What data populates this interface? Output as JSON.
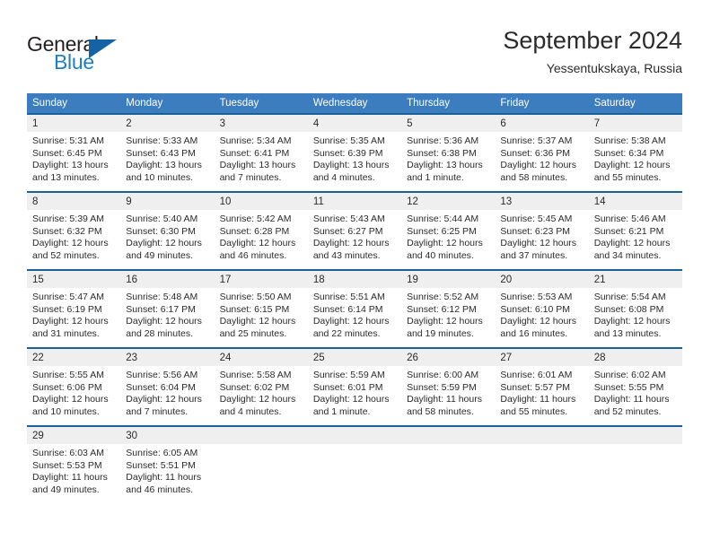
{
  "brand": {
    "word1": "General",
    "word2": "Blue",
    "logo_icon": "triangle-logo-icon",
    "colors": {
      "dark": "#231f20",
      "blue": "#1f7fc4",
      "triangle": "#1464a5"
    }
  },
  "header": {
    "month_title": "September 2024",
    "location": "Yessentukskaya, Russia"
  },
  "calendar": {
    "colors": {
      "header_bg": "#3b7dbf",
      "row_border": "#1a6099",
      "day_band_bg": "#efefef"
    },
    "weekdays": [
      "Sunday",
      "Monday",
      "Tuesday",
      "Wednesday",
      "Thursday",
      "Friday",
      "Saturday"
    ],
    "weeks": [
      [
        {
          "day": "1",
          "lines": [
            "Sunrise: 5:31 AM",
            "Sunset: 6:45 PM",
            "Daylight: 13 hours",
            "and 13 minutes."
          ]
        },
        {
          "day": "2",
          "lines": [
            "Sunrise: 5:33 AM",
            "Sunset: 6:43 PM",
            "Daylight: 13 hours",
            "and 10 minutes."
          ]
        },
        {
          "day": "3",
          "lines": [
            "Sunrise: 5:34 AM",
            "Sunset: 6:41 PM",
            "Daylight: 13 hours",
            "and 7 minutes."
          ]
        },
        {
          "day": "4",
          "lines": [
            "Sunrise: 5:35 AM",
            "Sunset: 6:39 PM",
            "Daylight: 13 hours",
            "and 4 minutes."
          ]
        },
        {
          "day": "5",
          "lines": [
            "Sunrise: 5:36 AM",
            "Sunset: 6:38 PM",
            "Daylight: 13 hours",
            "and 1 minute."
          ]
        },
        {
          "day": "6",
          "lines": [
            "Sunrise: 5:37 AM",
            "Sunset: 6:36 PM",
            "Daylight: 12 hours",
            "and 58 minutes."
          ]
        },
        {
          "day": "7",
          "lines": [
            "Sunrise: 5:38 AM",
            "Sunset: 6:34 PM",
            "Daylight: 12 hours",
            "and 55 minutes."
          ]
        }
      ],
      [
        {
          "day": "8",
          "lines": [
            "Sunrise: 5:39 AM",
            "Sunset: 6:32 PM",
            "Daylight: 12 hours",
            "and 52 minutes."
          ]
        },
        {
          "day": "9",
          "lines": [
            "Sunrise: 5:40 AM",
            "Sunset: 6:30 PM",
            "Daylight: 12 hours",
            "and 49 minutes."
          ]
        },
        {
          "day": "10",
          "lines": [
            "Sunrise: 5:42 AM",
            "Sunset: 6:28 PM",
            "Daylight: 12 hours",
            "and 46 minutes."
          ]
        },
        {
          "day": "11",
          "lines": [
            "Sunrise: 5:43 AM",
            "Sunset: 6:27 PM",
            "Daylight: 12 hours",
            "and 43 minutes."
          ]
        },
        {
          "day": "12",
          "lines": [
            "Sunrise: 5:44 AM",
            "Sunset: 6:25 PM",
            "Daylight: 12 hours",
            "and 40 minutes."
          ]
        },
        {
          "day": "13",
          "lines": [
            "Sunrise: 5:45 AM",
            "Sunset: 6:23 PM",
            "Daylight: 12 hours",
            "and 37 minutes."
          ]
        },
        {
          "day": "14",
          "lines": [
            "Sunrise: 5:46 AM",
            "Sunset: 6:21 PM",
            "Daylight: 12 hours",
            "and 34 minutes."
          ]
        }
      ],
      [
        {
          "day": "15",
          "lines": [
            "Sunrise: 5:47 AM",
            "Sunset: 6:19 PM",
            "Daylight: 12 hours",
            "and 31 minutes."
          ]
        },
        {
          "day": "16",
          "lines": [
            "Sunrise: 5:48 AM",
            "Sunset: 6:17 PM",
            "Daylight: 12 hours",
            "and 28 minutes."
          ]
        },
        {
          "day": "17",
          "lines": [
            "Sunrise: 5:50 AM",
            "Sunset: 6:15 PM",
            "Daylight: 12 hours",
            "and 25 minutes."
          ]
        },
        {
          "day": "18",
          "lines": [
            "Sunrise: 5:51 AM",
            "Sunset: 6:14 PM",
            "Daylight: 12 hours",
            "and 22 minutes."
          ]
        },
        {
          "day": "19",
          "lines": [
            "Sunrise: 5:52 AM",
            "Sunset: 6:12 PM",
            "Daylight: 12 hours",
            "and 19 minutes."
          ]
        },
        {
          "day": "20",
          "lines": [
            "Sunrise: 5:53 AM",
            "Sunset: 6:10 PM",
            "Daylight: 12 hours",
            "and 16 minutes."
          ]
        },
        {
          "day": "21",
          "lines": [
            "Sunrise: 5:54 AM",
            "Sunset: 6:08 PM",
            "Daylight: 12 hours",
            "and 13 minutes."
          ]
        }
      ],
      [
        {
          "day": "22",
          "lines": [
            "Sunrise: 5:55 AM",
            "Sunset: 6:06 PM",
            "Daylight: 12 hours",
            "and 10 minutes."
          ]
        },
        {
          "day": "23",
          "lines": [
            "Sunrise: 5:56 AM",
            "Sunset: 6:04 PM",
            "Daylight: 12 hours",
            "and 7 minutes."
          ]
        },
        {
          "day": "24",
          "lines": [
            "Sunrise: 5:58 AM",
            "Sunset: 6:02 PM",
            "Daylight: 12 hours",
            "and 4 minutes."
          ]
        },
        {
          "day": "25",
          "lines": [
            "Sunrise: 5:59 AM",
            "Sunset: 6:01 PM",
            "Daylight: 12 hours",
            "and 1 minute."
          ]
        },
        {
          "day": "26",
          "lines": [
            "Sunrise: 6:00 AM",
            "Sunset: 5:59 PM",
            "Daylight: 11 hours",
            "and 58 minutes."
          ]
        },
        {
          "day": "27",
          "lines": [
            "Sunrise: 6:01 AM",
            "Sunset: 5:57 PM",
            "Daylight: 11 hours",
            "and 55 minutes."
          ]
        },
        {
          "day": "28",
          "lines": [
            "Sunrise: 6:02 AM",
            "Sunset: 5:55 PM",
            "Daylight: 11 hours",
            "and 52 minutes."
          ]
        }
      ],
      [
        {
          "day": "29",
          "lines": [
            "Sunrise: 6:03 AM",
            "Sunset: 5:53 PM",
            "Daylight: 11 hours",
            "and 49 minutes."
          ]
        },
        {
          "day": "30",
          "lines": [
            "Sunrise: 6:05 AM",
            "Sunset: 5:51 PM",
            "Daylight: 11 hours",
            "and 46 minutes."
          ]
        },
        {
          "day": "",
          "lines": []
        },
        {
          "day": "",
          "lines": []
        },
        {
          "day": "",
          "lines": []
        },
        {
          "day": "",
          "lines": []
        },
        {
          "day": "",
          "lines": []
        }
      ]
    ]
  }
}
